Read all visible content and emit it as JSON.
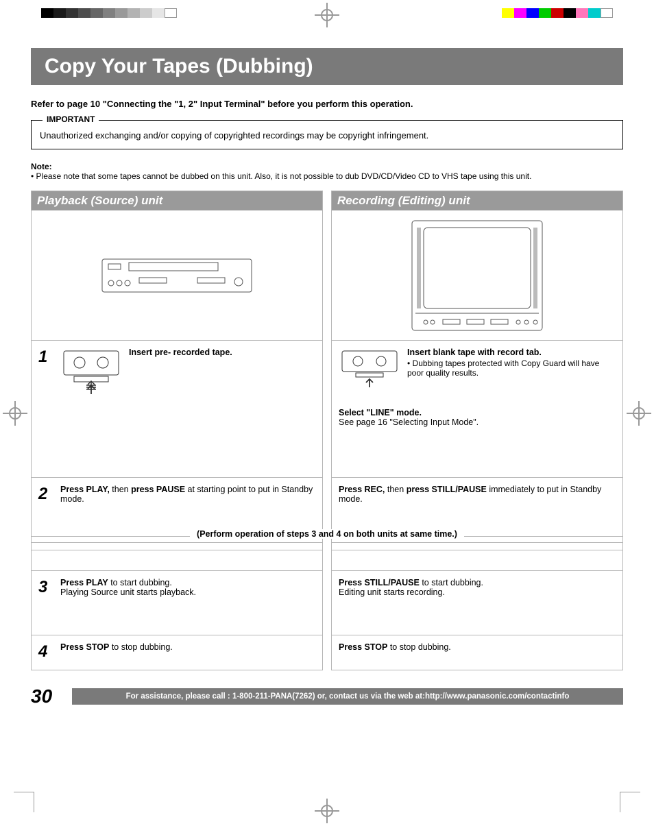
{
  "title": "Copy Your Tapes (Dubbing)",
  "intro": "Refer to page 10 \"Connecting the \"1, 2\" Input Terminal\" before you perform this operation.",
  "important": {
    "legend": "IMPORTANT",
    "text": "Unauthorized exchanging and/or copying of copyrighted recordings may be copyright infringement."
  },
  "note": {
    "head": "Note:",
    "bullet": "• Please note that some tapes cannot be dubbed on this unit. Also, it is not possible to dub DVD/CD/Video CD to VHS tape using this unit."
  },
  "left": {
    "head": "Playback (Source) unit",
    "step1": {
      "num": "1",
      "text_bold": "Insert pre- recorded tape."
    },
    "step2": {
      "num": "2",
      "a": "Press PLAY,",
      "b": " then ",
      "c": "press PAUSE",
      "d": " at starting point to put in Standby mode."
    },
    "step3": {
      "num": "3",
      "a": "Press PLAY",
      "b": " to start dubbing.",
      "c": "Playing Source unit starts playback."
    },
    "step4": {
      "num": "4",
      "a": "Press STOP",
      "b": " to stop dubbing."
    }
  },
  "right": {
    "head": "Recording (Editing) unit",
    "step1": {
      "a": "Insert blank tape with record tab.",
      "bullet": "• Dubbing tapes protected with Copy Guard will have poor quality results.",
      "b": "Select \"LINE\" mode.",
      "c": "See page 16 \"Selecting Input Mode\"."
    },
    "step2": {
      "a": "Press REC,",
      "b": " then ",
      "c": "press STILL/PAUSE",
      "d": " immediately to put in Standby mode."
    },
    "step3": {
      "a": "Press STILL/PAUSE",
      "b": " to start dubbing.",
      "c": "Editing unit starts recording."
    },
    "step4": {
      "a": "Press STOP",
      "b": " to stop dubbing."
    }
  },
  "divider": "(Perform operation of steps 3 and 4 on both units at same time.)",
  "footer": {
    "page": "30",
    "bar": "For assistance, please call : 1-800-211-PANA(7262) or, contact us via the web at:http://www.panasonic.com/contactinfo"
  }
}
